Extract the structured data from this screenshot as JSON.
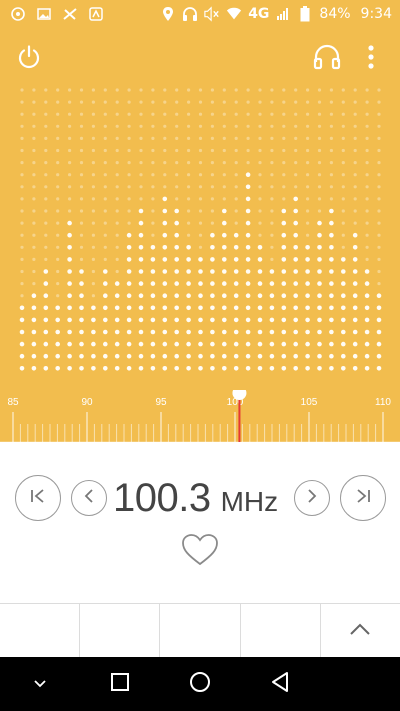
{
  "status_bar": {
    "network": "4G",
    "battery": "84%",
    "time": "9:34",
    "left_icons": [
      "notification-icon",
      "image-icon",
      "no-sim-icon",
      "app-icon"
    ],
    "right_icons": [
      "location-icon",
      "headset-icon",
      "mute-icon",
      "wifi-icon",
      "signal-icon",
      "battery-icon"
    ]
  },
  "toolbar": {
    "power_icon": "power-icon",
    "headset_icon": "headset-icon",
    "more_icon": "more-vert-icon"
  },
  "scale": {
    "labels": [
      "85",
      "90",
      "95",
      "100",
      "105",
      "110"
    ],
    "min": 85,
    "max": 110,
    "current": 100.3
  },
  "tuner": {
    "frequency": "100.3",
    "unit": "MHz",
    "prev_station_icon": "skip-previous-icon",
    "step_down_icon": "chevron-left-icon",
    "step_up_icon": "chevron-right-icon",
    "next_station_icon": "skip-next-icon",
    "favorite_icon": "heart-outline-icon"
  },
  "presets": {
    "expand_icon": "chevron-up-icon"
  },
  "navbar": {
    "icons": [
      "chevron-down-icon",
      "recent-apps-icon",
      "home-icon",
      "back-icon"
    ]
  },
  "colors": {
    "accent": "#f2bd4e",
    "needle": "#e53935",
    "text": "#444444"
  }
}
